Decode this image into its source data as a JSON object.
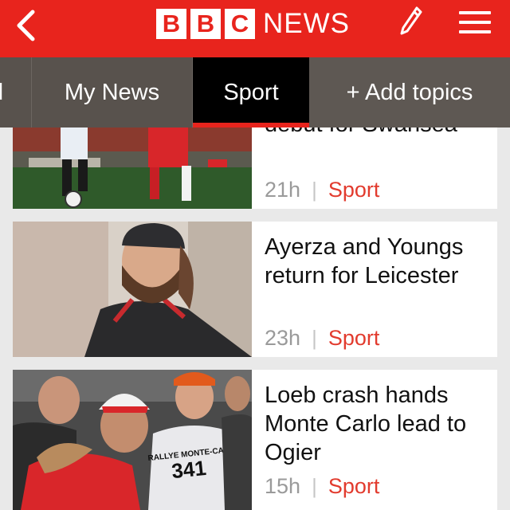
{
  "header": {
    "logo_letters": [
      "B",
      "B",
      "C"
    ],
    "logo_word": "NEWS"
  },
  "tabs": [
    {
      "label": "d"
    },
    {
      "label": "My News"
    },
    {
      "label": "Sport"
    },
    {
      "label": "+ Add topics"
    }
  ],
  "stories": [
    {
      "headline": "debut for Swansea",
      "time": "21h",
      "category": "Sport",
      "separator": "|"
    },
    {
      "headline": "Ayerza and Youngs return for Leicester",
      "time": "23h",
      "category": "Sport",
      "separator": "|"
    },
    {
      "headline": "Loeb crash hands Monte Carlo lead to Ogier",
      "time": "15h",
      "category": "Sport",
      "separator": "|"
    }
  ],
  "images": {
    "rally_bib_text": "RALLYE MONTE-CARLO",
    "rally_number": "341"
  },
  "colors": {
    "bbc_red": "#e8241d",
    "tab_bar": "#58524d",
    "active_tab": "#000000",
    "category": "#e23b2e"
  }
}
